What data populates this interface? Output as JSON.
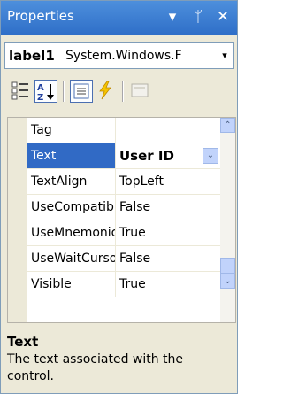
{
  "window": {
    "title": "Properties",
    "dropdown_glyph": "▾",
    "pin_glyph": "ᛘ",
    "close_glyph": "✕"
  },
  "object_selector": {
    "name": "label1",
    "type": "System.Windows.F",
    "arrow": "▾"
  },
  "toolbar": {
    "buttons": [
      {
        "name": "categorized-icon",
        "active": false
      },
      {
        "name": "alphabetical-sort-icon",
        "active": true
      },
      {
        "name": "properties-icon",
        "active": true
      },
      {
        "name": "events-lightning-icon",
        "active": false
      },
      {
        "name": "property-pages-icon",
        "active": false
      }
    ]
  },
  "grid": {
    "rows": [
      {
        "name": "Tag",
        "value": ""
      },
      {
        "name": "Text",
        "value": "User ID",
        "selected": true,
        "has_dropdown": true
      },
      {
        "name": "TextAlign",
        "value": "TopLeft"
      },
      {
        "name": "UseCompatib",
        "value": "False"
      },
      {
        "name": "UseMnemonic",
        "value": "True"
      },
      {
        "name": "UseWaitCursor",
        "value": "False"
      },
      {
        "name": "Visible",
        "value": "True"
      }
    ],
    "dropdown_glyph": "⌄",
    "scroll_up": "⌃",
    "scroll_down": "⌄"
  },
  "description": {
    "title": "Text",
    "text": "The text associated with the control."
  },
  "colors": {
    "title_bar": "#3c7fd8",
    "selection": "#316ac5",
    "panel": "#ece9d8",
    "scroll_button": "#c1d3fb"
  }
}
